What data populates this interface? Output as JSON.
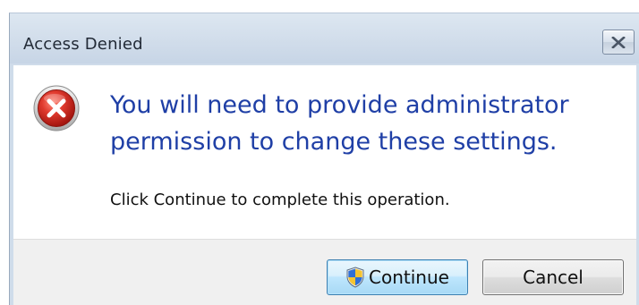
{
  "window": {
    "title": "Access Denied",
    "close_icon": "close-icon"
  },
  "message": {
    "icon": "error-icon",
    "main_instruction": "You will need to provide administrator permission to change these settings.",
    "content": "Click Continue to complete this operation."
  },
  "buttons": {
    "continue_label": "Continue",
    "continue_icon": "uac-shield-icon",
    "cancel_label": "Cancel"
  },
  "colors": {
    "main_instruction": "#1f3fa6",
    "error_red": "#d22b2b",
    "default_button_border": "#3c7fb1"
  }
}
